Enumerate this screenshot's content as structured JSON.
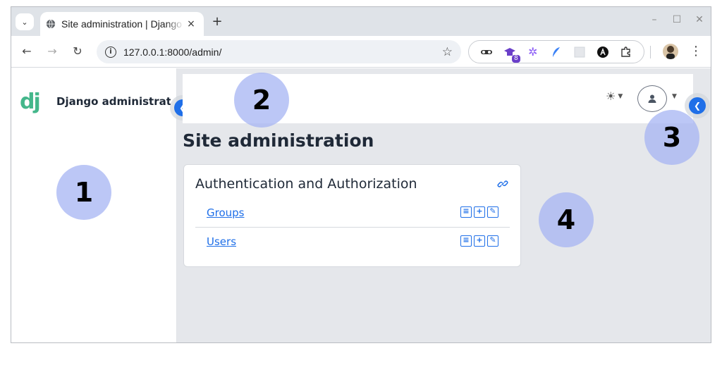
{
  "browser": {
    "tab_title": "Site administration | Django site admin",
    "url": "127.0.0.1:8000/admin/",
    "new_tab": "+",
    "close_tab": "×",
    "minimize": "–",
    "maximize": "☐",
    "close_window": "✕",
    "extension_badge": "8"
  },
  "sidebar": {
    "logo": "dj",
    "brand_title": "Django administration"
  },
  "main": {
    "page_title": "Site administration",
    "module": {
      "title": "Authentication and Authorization",
      "models": [
        {
          "label": "Groups"
        },
        {
          "label": "Users"
        }
      ]
    }
  },
  "markers": [
    "1",
    "2",
    "3",
    "4"
  ],
  "colors": {
    "accent": "#1f6fe8",
    "logo": "#44b78b",
    "marker": "#a5b4f3"
  }
}
